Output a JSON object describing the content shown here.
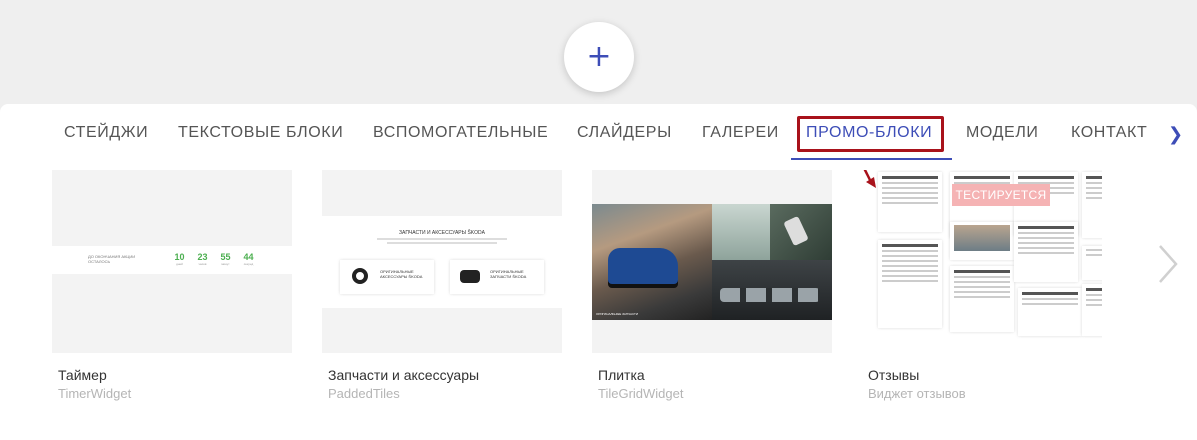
{
  "add_button": {
    "label": "+"
  },
  "tabs": [
    {
      "label": "СТЕЙДЖИ",
      "active": false
    },
    {
      "label": "ТЕКСТОВЫЕ БЛОКИ",
      "active": false
    },
    {
      "label": "ВСПОМОГАТЕЛЬНЫЕ",
      "active": false
    },
    {
      "label": "СЛАЙДЕРЫ",
      "active": false
    },
    {
      "label": "ГАЛЕРЕИ",
      "active": false
    },
    {
      "label": "ПРОМО-БЛОКИ",
      "active": true
    },
    {
      "label": "МОДЕЛИ",
      "active": false
    },
    {
      "label": "КОНТАКТ",
      "active": false
    }
  ],
  "tabs_next_icon": "chevron-right-icon",
  "accent_color": "#3d4db7",
  "highlight_color": "#a8121b",
  "cards": [
    {
      "title": "Таймер",
      "subtitle": "TimerWidget",
      "preview": {
        "label": "ДО ОКОНЧАНИЯ АКЦИИ ОСТАЛОСЬ",
        "numbers": [
          {
            "value": "10",
            "unit": "дней"
          },
          {
            "value": "23",
            "unit": "часов"
          },
          {
            "value": "55",
            "unit": "минут"
          },
          {
            "value": "44",
            "unit": "секунд"
          }
        ]
      }
    },
    {
      "title": "Запчасти и аксессуары",
      "subtitle": "PaddedTiles",
      "preview": {
        "heading": "ЗАПЧАСТИ И АКСЕССУАРЫ ŠKODA",
        "tiles": [
          "ОРИГИНАЛЬНЫЕ АКСЕССУАРЫ ŠKODA",
          "ОРИГИНАЛЬНЫЕ ЗАПЧАСТИ ŠKODA"
        ]
      }
    },
    {
      "title": "Плитка",
      "subtitle": "TileGridWidget",
      "preview": {
        "caption": "ОРИГИНАЛЬНЫЕ ЗАПЧАСТИ"
      }
    },
    {
      "title": "Отзывы",
      "subtitle": "Виджет отзывов",
      "preview": {
        "badge": "ТЕСТИРУЕТСЯ"
      }
    }
  ],
  "slider_next_icon": "chevron-right-icon"
}
